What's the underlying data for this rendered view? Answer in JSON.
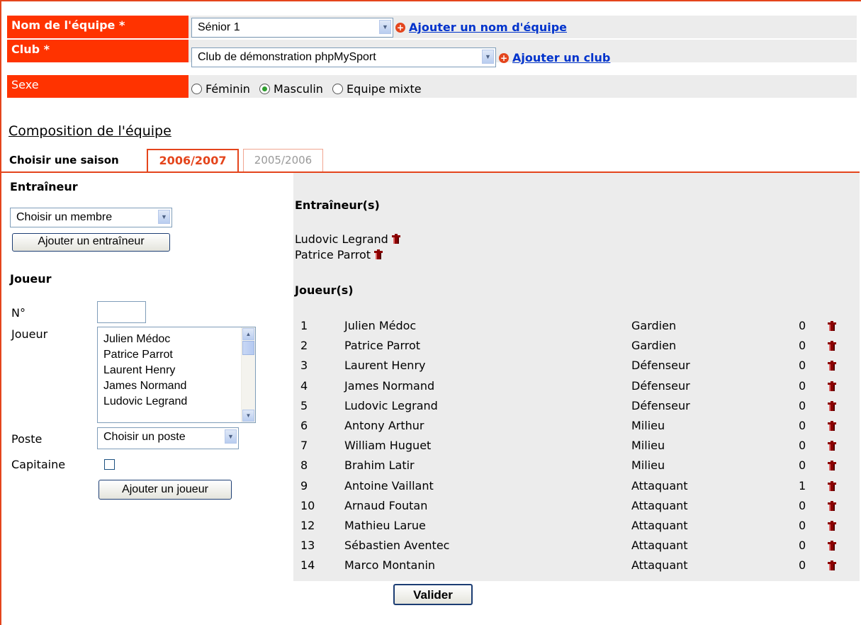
{
  "team_form": {
    "team_name": {
      "label": "Nom de l'équipe *",
      "value": "Sénior 1",
      "add_link": "Ajouter un nom d'équipe"
    },
    "club": {
      "label": "Club *",
      "value": "Club de démonstration phpMySport",
      "add_link": "Ajouter un club"
    },
    "sex": {
      "label": "Sexe",
      "options": [
        "Féminin",
        "Masculin",
        "Equipe mixte"
      ],
      "selected": "Masculin"
    }
  },
  "composition": {
    "heading": "Composition de l'équipe",
    "season_label": "Choisir une saison",
    "seasons": [
      "2006/2007",
      "2005/2006"
    ],
    "active_season": "2006/2007"
  },
  "coach_form": {
    "title": "Entraîneur",
    "member_select": "Choisir un membre",
    "add_button": "Ajouter un entraîneur"
  },
  "player_form": {
    "title": "Joueur",
    "number_label": "N°",
    "number_value": "",
    "player_label": "Joueur",
    "player_list": [
      "Julien Médoc",
      "Patrice Parrot",
      "Laurent Henry",
      "James Normand",
      "Ludovic Legrand"
    ],
    "position_label": "Poste",
    "position_select": "Choisir un poste",
    "captain_label": "Capitaine",
    "captain_checked": false,
    "add_button": "Ajouter un joueur"
  },
  "coaches": {
    "title": "Entraîneur(s)",
    "list": [
      "Ludovic Legrand",
      "Patrice Parrot"
    ]
  },
  "players": {
    "title": "Joueur(s)",
    "rows": [
      {
        "num": "1",
        "name": "Julien Médoc",
        "position": "Gardien",
        "count": "0"
      },
      {
        "num": "2",
        "name": "Patrice Parrot",
        "position": "Gardien",
        "count": "0"
      },
      {
        "num": "3",
        "name": "Laurent Henry",
        "position": "Défenseur",
        "count": "0"
      },
      {
        "num": "4",
        "name": "James Normand",
        "position": "Défenseur",
        "count": "0"
      },
      {
        "num": "5",
        "name": "Ludovic Legrand",
        "position": "Défenseur",
        "count": "0"
      },
      {
        "num": "6",
        "name": "Antony Arthur",
        "position": "Milieu",
        "count": "0"
      },
      {
        "num": "7",
        "name": "William Huguet",
        "position": "Milieu",
        "count": "0"
      },
      {
        "num": "8",
        "name": "Brahim Latir",
        "position": "Milieu",
        "count": "0"
      },
      {
        "num": "9",
        "name": "Antoine Vaillant",
        "position": "Attaquant",
        "count": "1"
      },
      {
        "num": "10",
        "name": "Arnaud Foutan",
        "position": "Attaquant",
        "count": "0"
      },
      {
        "num": "12",
        "name": "Mathieu Larue",
        "position": "Attaquant",
        "count": "0"
      },
      {
        "num": "13",
        "name": "Sébastien Aventec",
        "position": "Attaquant",
        "count": "0"
      },
      {
        "num": "14",
        "name": "Marco Montanin",
        "position": "Attaquant",
        "count": "0"
      }
    ]
  },
  "submit_label": "Valider",
  "colors": {
    "accent": "#ff3300",
    "border": "#e4451c",
    "panel": "#ececec",
    "link": "#0033cc",
    "trash": "#8b0000"
  }
}
